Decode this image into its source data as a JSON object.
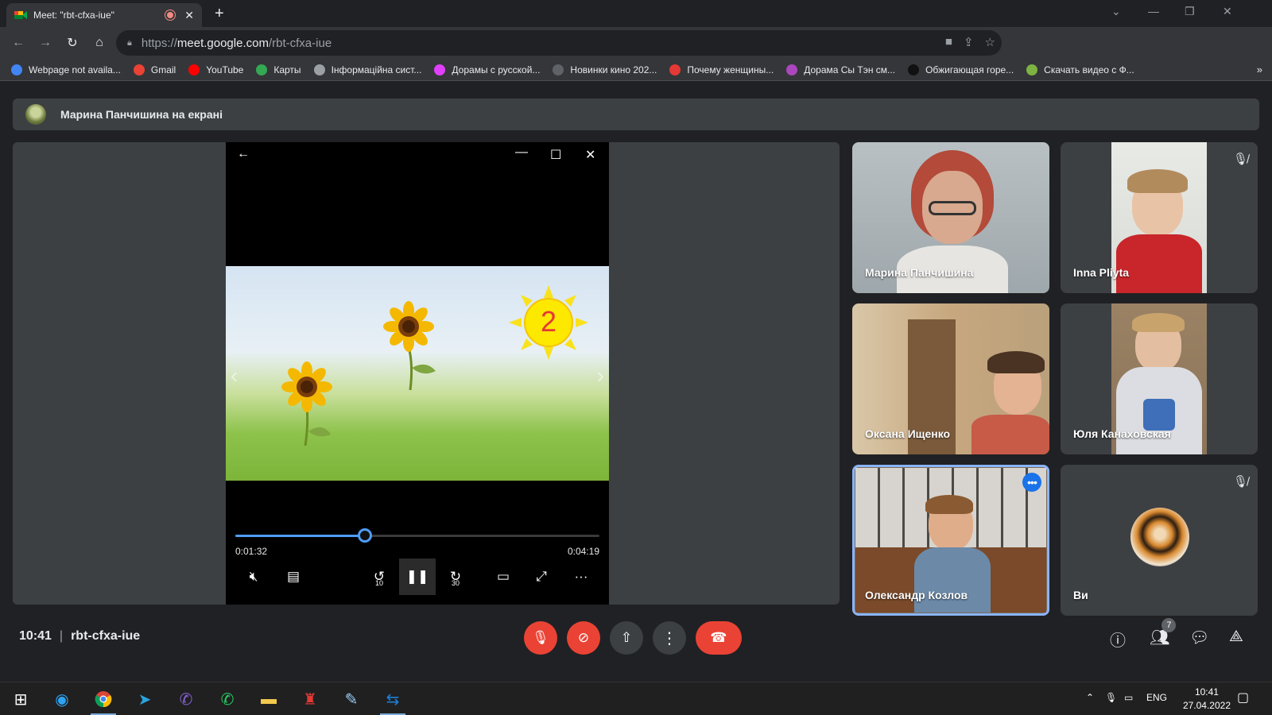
{
  "browser": {
    "tab_title": "Meet: \"rbt-cfxa-iue\"",
    "url_prefix": "https://",
    "url_host": "meet.google.com",
    "url_path": "/rbt-cfxa-iue"
  },
  "bookmarks": [
    {
      "label": "Webpage not availa...",
      "color": "#4285f4"
    },
    {
      "label": "Gmail",
      "color": "#ea4335"
    },
    {
      "label": "YouTube",
      "color": "#ff0000"
    },
    {
      "label": "Карты",
      "color": "#34a853"
    },
    {
      "label": "Інформаційна сист...",
      "color": "#9aa0a6"
    },
    {
      "label": "Дорамы с русской...",
      "color": "#e040fb"
    },
    {
      "label": "Новинки кино 202...",
      "color": "#5f6368"
    },
    {
      "label": "Почему женщины...",
      "color": "#e53935"
    },
    {
      "label": "Дорама Сы Тэн см...",
      "color": "#ab47bc"
    },
    {
      "label": "Обжигающая горе...",
      "color": "#111111"
    },
    {
      "label": "Скачать видео с Ф...",
      "color": "#7cb342"
    }
  ],
  "bookmarks_more": "»",
  "meet": {
    "presenting_text": "Марина Панчишина на екрані",
    "player": {
      "current_time": "0:01:32",
      "total_time": "0:04:19",
      "progress_fraction": 0.355,
      "skip_back_label": "10",
      "skip_fwd_label": "30",
      "sun_number": "2"
    },
    "participants": [
      {
        "name": "Марина Панчишина",
        "muted": false
      },
      {
        "name": "Inna Pliyta",
        "muted": true
      },
      {
        "name": "Оксана Ищенко",
        "muted": false
      },
      {
        "name": "Юля Канаховская",
        "muted": false
      },
      {
        "name": "Олександр Козлов",
        "muted": false,
        "speaking": true
      },
      {
        "name": "Ви",
        "muted": true
      }
    ],
    "bottom": {
      "time": "10:41",
      "separator": "|",
      "meeting_code": "rbt-cfxa-iue",
      "participant_count": "7"
    }
  },
  "taskbar": {
    "lang": "ENG",
    "time": "10:41",
    "date": "27.04.2022"
  }
}
